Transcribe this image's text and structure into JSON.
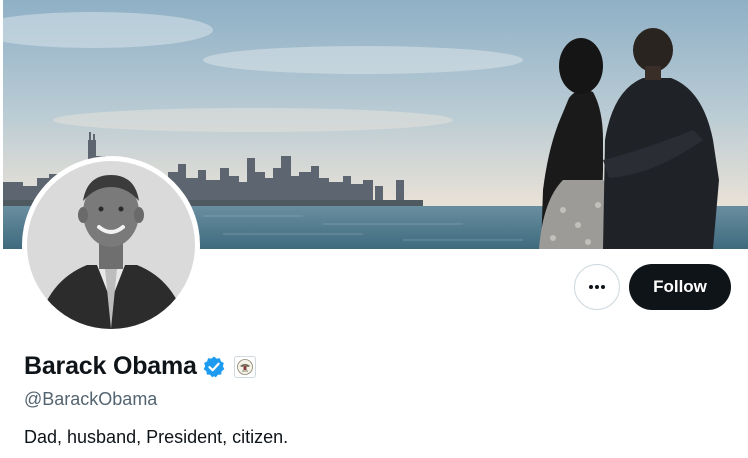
{
  "profile": {
    "display_name": "Barack Obama",
    "handle": "@BarackObama",
    "bio": "Dad, husband, President, citizen.",
    "verified": true,
    "government_affiliation_badge": true
  },
  "actions": {
    "follow_label": "Follow",
    "more_icon": "more-horizontal-icon"
  },
  "colors": {
    "verified_blue": "#1d9bf0",
    "follow_button_bg": "#0f1419",
    "handle_gray": "#536471",
    "border": "#cfd9de"
  }
}
